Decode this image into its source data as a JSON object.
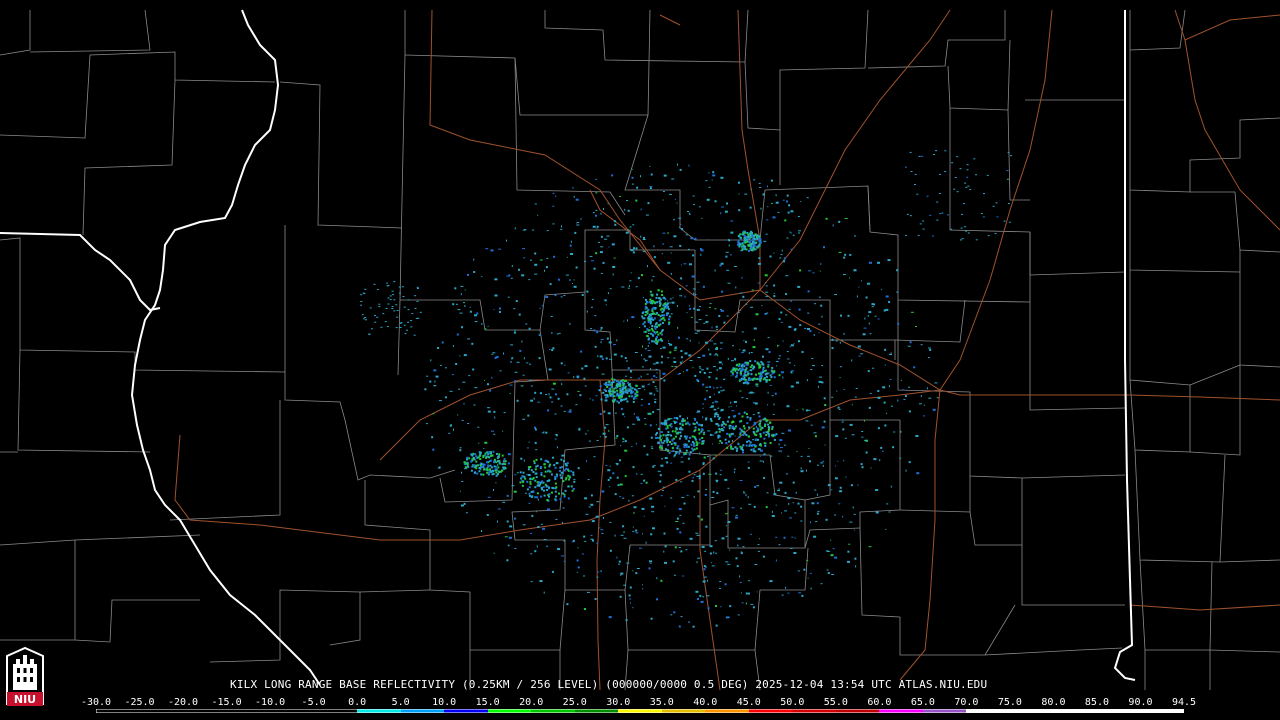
{
  "caption": "KILX LONG RANGE BASE REFLECTIVITY (0.25KM / 256 LEVEL) (000000/0000 0.5 DEG) 2025-12-04 13:54 UTC  ATLAS.NIU.EDU",
  "logo": {
    "text": "NIU",
    "icon": "niu-tower-icon",
    "color": "#c8102e"
  },
  "colorbar": {
    "labels": [
      "-30.0",
      "-25.0",
      "-20.0",
      "-15.0",
      "-10.0",
      "-5.0",
      "0.0",
      "5.0",
      "10.0",
      "15.0",
      "20.0",
      "25.0",
      "30.0",
      "35.0",
      "40.0",
      "45.0",
      "50.0",
      "55.0",
      "60.0",
      "65.0",
      "70.0",
      "75.0",
      "80.0",
      "85.0",
      "90.0",
      "94.5"
    ],
    "colors": [
      "#000000",
      "#000000",
      "#000000",
      "#000000",
      "#000000",
      "#000000",
      "#04e9e7",
      "#019ff4",
      "#0300f4",
      "#02fd02",
      "#01c501",
      "#008e00",
      "#fdf802",
      "#e5bc00",
      "#fd9500",
      "#fd0000",
      "#d40000",
      "#bc0000",
      "#f800fd",
      "#9854c6",
      "#fdfdfd",
      "#ffffff",
      "#ffffff",
      "#ffffff",
      "#ffffff"
    ]
  },
  "map_colors": {
    "background": "#000000",
    "county_lines": "#8a8a8a",
    "state_lines": "#ffffff",
    "roads": "#a0522d",
    "echo_low": "#2aa7c9",
    "echo_mid": "#1e6fd8",
    "echo_high": "#22c93a"
  }
}
